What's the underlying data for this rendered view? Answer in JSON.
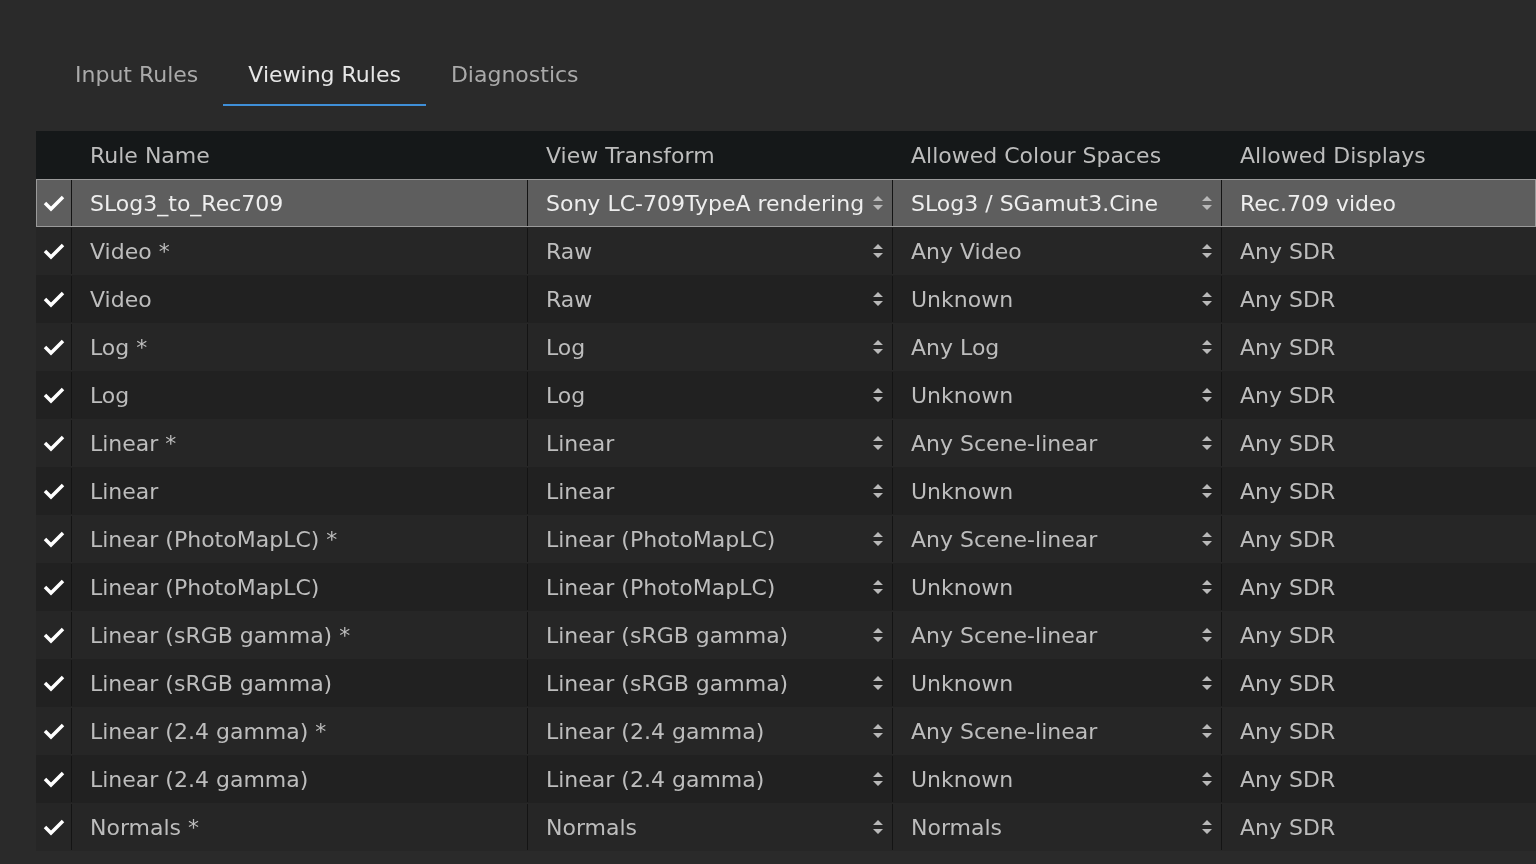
{
  "tabs": [
    {
      "label": "Input Rules",
      "selected": false
    },
    {
      "label": "Viewing Rules",
      "selected": true
    },
    {
      "label": "Diagnostics",
      "selected": false
    }
  ],
  "table": {
    "columns": [
      "Rule Name",
      "View Transform",
      "Allowed Colour Spaces",
      "Allowed Displays"
    ],
    "rows": [
      {
        "checked": true,
        "selected": true,
        "name": "SLog3_to_Rec709",
        "view_transform": "Sony LC-709TypeA rendering",
        "colour_spaces": "SLog3 / SGamut3.Cine",
        "displays": "Rec.709 video"
      },
      {
        "checked": true,
        "selected": false,
        "name": "Video *",
        "view_transform": "Raw",
        "colour_spaces": "Any Video",
        "displays": "Any SDR"
      },
      {
        "checked": true,
        "selected": false,
        "name": "Video",
        "view_transform": "Raw",
        "colour_spaces": "Unknown",
        "displays": "Any SDR"
      },
      {
        "checked": true,
        "selected": false,
        "name": "Log *",
        "view_transform": "Log",
        "colour_spaces": "Any Log",
        "displays": "Any SDR"
      },
      {
        "checked": true,
        "selected": false,
        "name": "Log",
        "view_transform": "Log",
        "colour_spaces": "Unknown",
        "displays": "Any SDR"
      },
      {
        "checked": true,
        "selected": false,
        "name": "Linear *",
        "view_transform": "Linear",
        "colour_spaces": "Any Scene-linear",
        "displays": "Any SDR"
      },
      {
        "checked": true,
        "selected": false,
        "name": "Linear",
        "view_transform": "Linear",
        "colour_spaces": "Unknown",
        "displays": "Any SDR"
      },
      {
        "checked": true,
        "selected": false,
        "name": "Linear (PhotoMapLC) *",
        "view_transform": "Linear (PhotoMapLC)",
        "colour_spaces": "Any Scene-linear",
        "displays": "Any SDR"
      },
      {
        "checked": true,
        "selected": false,
        "name": "Linear (PhotoMapLC)",
        "view_transform": "Linear (PhotoMapLC)",
        "colour_spaces": "Unknown",
        "displays": "Any SDR"
      },
      {
        "checked": true,
        "selected": false,
        "name": "Linear (sRGB gamma) *",
        "view_transform": "Linear (sRGB gamma)",
        "colour_spaces": "Any Scene-linear",
        "displays": "Any SDR"
      },
      {
        "checked": true,
        "selected": false,
        "name": "Linear (sRGB gamma)",
        "view_transform": "Linear (sRGB gamma)",
        "colour_spaces": "Unknown",
        "displays": "Any SDR"
      },
      {
        "checked": true,
        "selected": false,
        "name": "Linear (2.4 gamma) *",
        "view_transform": "Linear (2.4 gamma)",
        "colour_spaces": "Any Scene-linear",
        "displays": "Any SDR"
      },
      {
        "checked": true,
        "selected": false,
        "name": "Linear (2.4 gamma)",
        "view_transform": "Linear (2.4 gamma)",
        "colour_spaces": "Unknown",
        "displays": "Any SDR"
      },
      {
        "checked": true,
        "selected": false,
        "name": "Normals *",
        "view_transform": "Normals",
        "colour_spaces": "Normals",
        "displays": "Any SDR"
      }
    ]
  }
}
